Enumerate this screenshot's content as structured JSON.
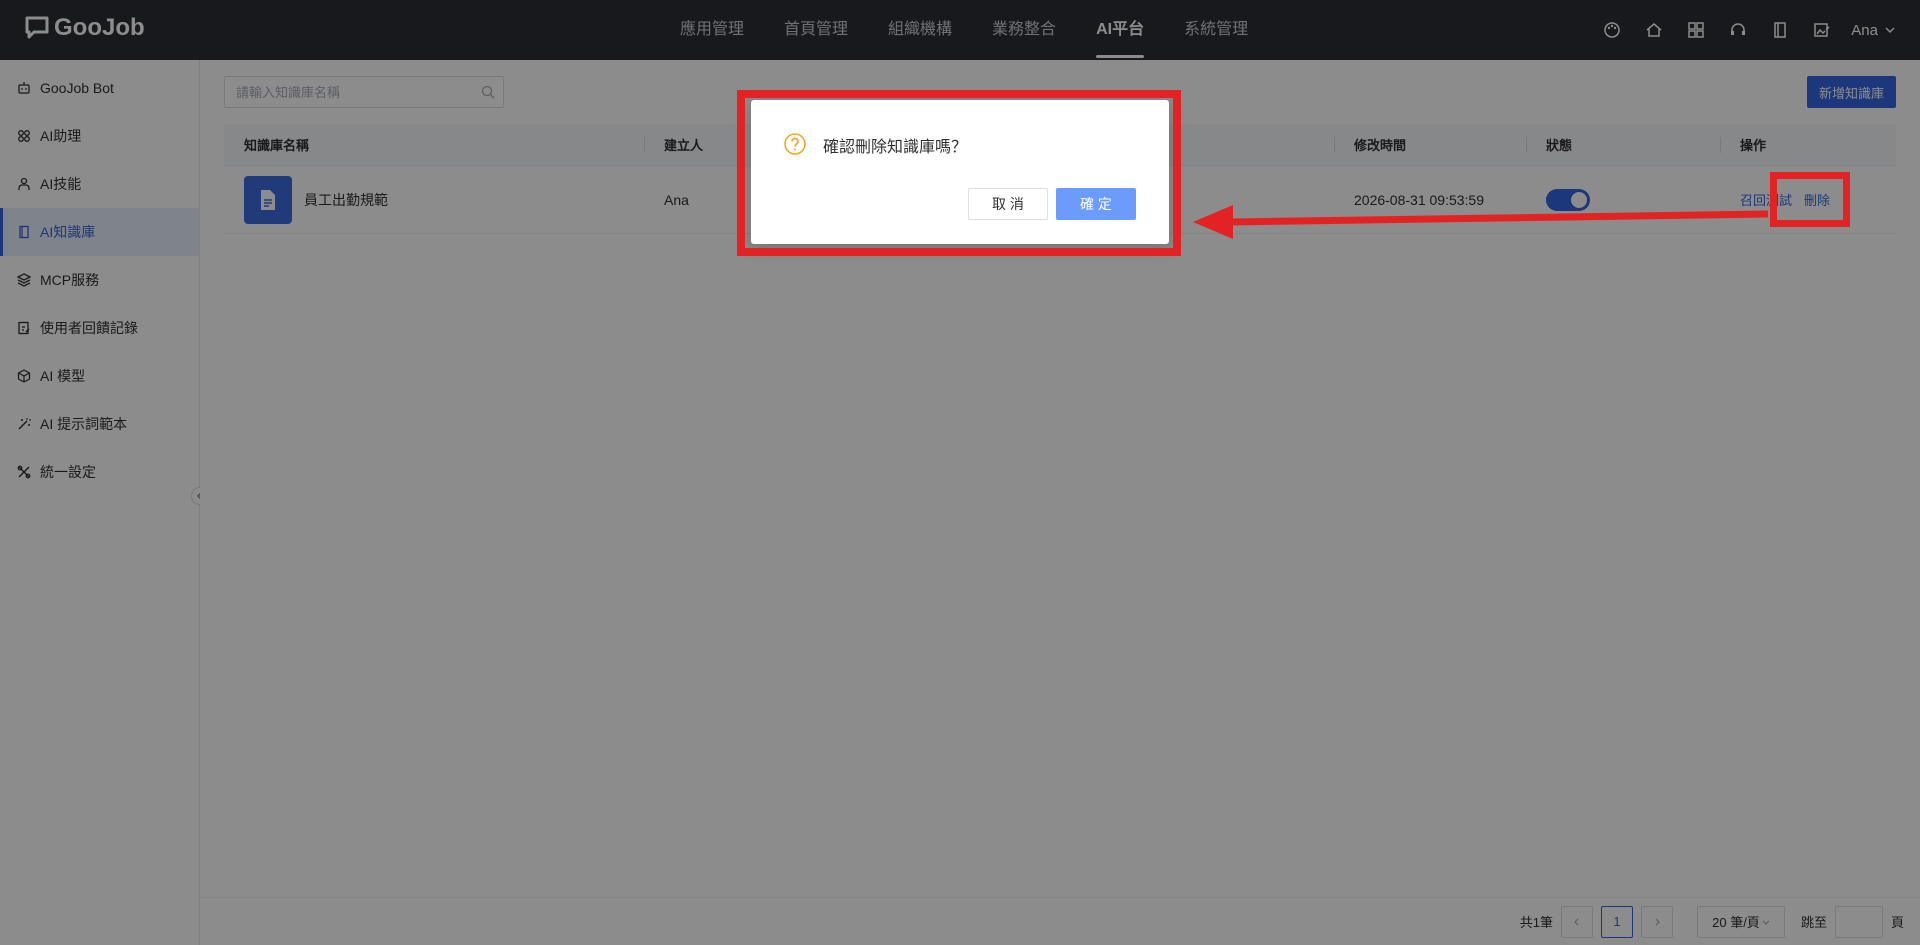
{
  "app": {
    "name": "GooJob"
  },
  "top_nav": {
    "items": [
      {
        "label": "應用管理",
        "active": false
      },
      {
        "label": "首頁管理",
        "active": false
      },
      {
        "label": "組織機構",
        "active": false
      },
      {
        "label": "業務整合",
        "active": false
      },
      {
        "label": "AI平台",
        "active": true
      },
      {
        "label": "系統管理",
        "active": false
      }
    ],
    "icons": [
      "palette-icon",
      "home-icon",
      "apps-grid-icon",
      "headset-icon",
      "book-icon",
      "image-edit-icon"
    ],
    "user": "Ana"
  },
  "sidebar": {
    "items": [
      {
        "label": "GooJob Bot",
        "icon": "robot-icon"
      },
      {
        "label": "AI助理",
        "icon": "grid-icon"
      },
      {
        "label": "AI技能",
        "icon": "skill-icon"
      },
      {
        "label": "AI知識庫",
        "icon": "book-icon",
        "active": true
      },
      {
        "label": "MCP服務",
        "icon": "layers-icon"
      },
      {
        "label": "使用者回饋記錄",
        "icon": "feedback-icon"
      },
      {
        "label": "AI 模型",
        "icon": "cube-icon"
      },
      {
        "label": "AI 提示詞範本",
        "icon": "magic-wand-icon"
      },
      {
        "label": "統一設定",
        "icon": "tools-icon"
      }
    ]
  },
  "toolbar": {
    "search_placeholder": "請輸入知識庫名稱",
    "add_label": "新增知識庫"
  },
  "table": {
    "columns": [
      "知識庫名稱",
      "建立人",
      "",
      "修改時間",
      "狀態",
      "操作"
    ],
    "rows": [
      {
        "name": "員工出勤規範",
        "creator": "Ana",
        "modified": "2026-08-31 09:53:59",
        "status_on": true,
        "actions": [
          "召回測試",
          "刪除"
        ]
      }
    ]
  },
  "pagination": {
    "total_label": "共1筆",
    "current_page": "1",
    "page_size_label": "20 筆/頁",
    "jump_label": "跳至",
    "page_suffix": "頁"
  },
  "dialog": {
    "title": "確認刪除知識庫嗎？",
    "cancel_label": "取 消",
    "ok_label": "確 定"
  },
  "colors": {
    "accent": "#3464e0",
    "topbar": "#2b2f36",
    "annotation": "#e32323",
    "warning": "#f5a623"
  }
}
